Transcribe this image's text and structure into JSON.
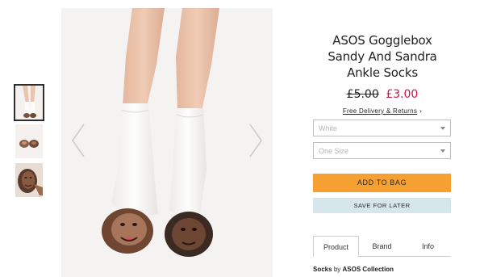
{
  "product": {
    "title": "ASOS Gogglebox Sandy And Sandra Ankle Socks",
    "price_old": "£5.00",
    "price_new": "£3.00",
    "delivery_link": "Free Delivery & Returns",
    "delivery_chevron": "›"
  },
  "options": {
    "color_placeholder": "White",
    "size_placeholder": "One Size"
  },
  "actions": {
    "add_to_bag": "ADD TO BAG",
    "save_for_later": "SAVE FOR LATER"
  },
  "tabs": [
    {
      "label": "Product",
      "active": true
    },
    {
      "label": "Brand",
      "active": false
    },
    {
      "label": "Info",
      "active": false
    }
  ],
  "byline": {
    "category": "Socks",
    "by": "by",
    "brand": "ASOS Collection"
  },
  "gallery": {
    "thumbnail_count": 3,
    "active_index": 0,
    "icons": [
      "chevron-left-icon",
      "chevron-right-icon"
    ]
  },
  "colors": {
    "add_to_bag_bg": "#f7a032",
    "save_for_later_bg": "#d5e7ea",
    "sale_price": "#d01345"
  }
}
